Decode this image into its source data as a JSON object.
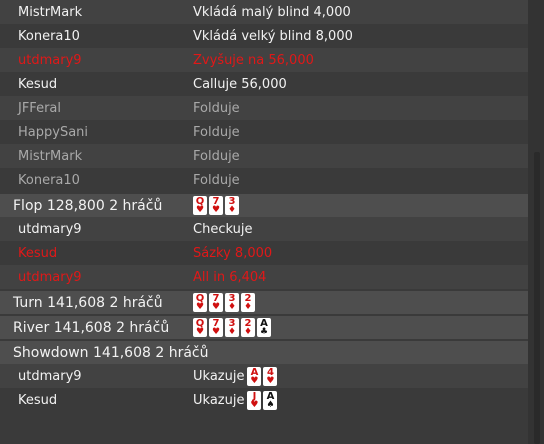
{
  "preflop_actions": [
    {
      "player": "MistrMark",
      "action": "Vkládá malý blind 4,000",
      "style": "normal"
    },
    {
      "player": "Konera10",
      "action": "Vkládá velký blind 8,000",
      "style": "normal"
    },
    {
      "player": "utdmary9",
      "action": "Zvyšuje na 56,000",
      "style": "red"
    },
    {
      "player": "Kesud",
      "action": "Calluje 56,000",
      "style": "normal"
    },
    {
      "player": "JFFeral",
      "action": "Folduje",
      "style": "folded"
    },
    {
      "player": "HappySani",
      "action": "Folduje",
      "style": "folded"
    },
    {
      "player": "MistrMark",
      "action": "Folduje",
      "style": "folded"
    },
    {
      "player": "Konera10",
      "action": "Folduje",
      "style": "folded"
    }
  ],
  "flop": {
    "title": "Flop  128,800  2 hráčů",
    "cards": [
      {
        "rank": "Q",
        "suit": "♥",
        "color": "red"
      },
      {
        "rank": "7",
        "suit": "♥",
        "color": "red"
      },
      {
        "rank": "3",
        "suit": "♦",
        "color": "red"
      }
    ],
    "actions": [
      {
        "player": "utdmary9",
        "action": "Checkuje",
        "style": "normal"
      },
      {
        "player": "Kesud",
        "action": "Sázky 8,000",
        "style": "red"
      },
      {
        "player": "utdmary9",
        "action": "All in 6,404",
        "style": "red"
      }
    ]
  },
  "turn": {
    "title": "Turn  141,608  2 hráčů",
    "cards": [
      {
        "rank": "Q",
        "suit": "♥",
        "color": "red"
      },
      {
        "rank": "7",
        "suit": "♥",
        "color": "red"
      },
      {
        "rank": "3",
        "suit": "♦",
        "color": "red"
      },
      {
        "rank": "2",
        "suit": "♦",
        "color": "red"
      }
    ]
  },
  "river": {
    "title": "River  141,608  2 hráčů",
    "cards": [
      {
        "rank": "Q",
        "suit": "♥",
        "color": "red"
      },
      {
        "rank": "7",
        "suit": "♥",
        "color": "red"
      },
      {
        "rank": "3",
        "suit": "♦",
        "color": "red"
      },
      {
        "rank": "2",
        "suit": "♦",
        "color": "red"
      },
      {
        "rank": "A",
        "suit": "♣",
        "color": "black"
      }
    ]
  },
  "showdown": {
    "title": "Showdown  141,608  2 hráčů",
    "actions": [
      {
        "player": "utdmary9",
        "action": "Ukazuje",
        "cards": [
          {
            "rank": "A",
            "suit": "♥",
            "color": "red"
          },
          {
            "rank": "4",
            "suit": "♥",
            "color": "red"
          }
        ]
      },
      {
        "player": "Kesud",
        "action": "Ukazuje",
        "cards": [
          {
            "rank": "J",
            "suit": "♥",
            "color": "red"
          },
          {
            "rank": "A",
            "suit": "♠",
            "color": "black"
          }
        ]
      }
    ]
  }
}
